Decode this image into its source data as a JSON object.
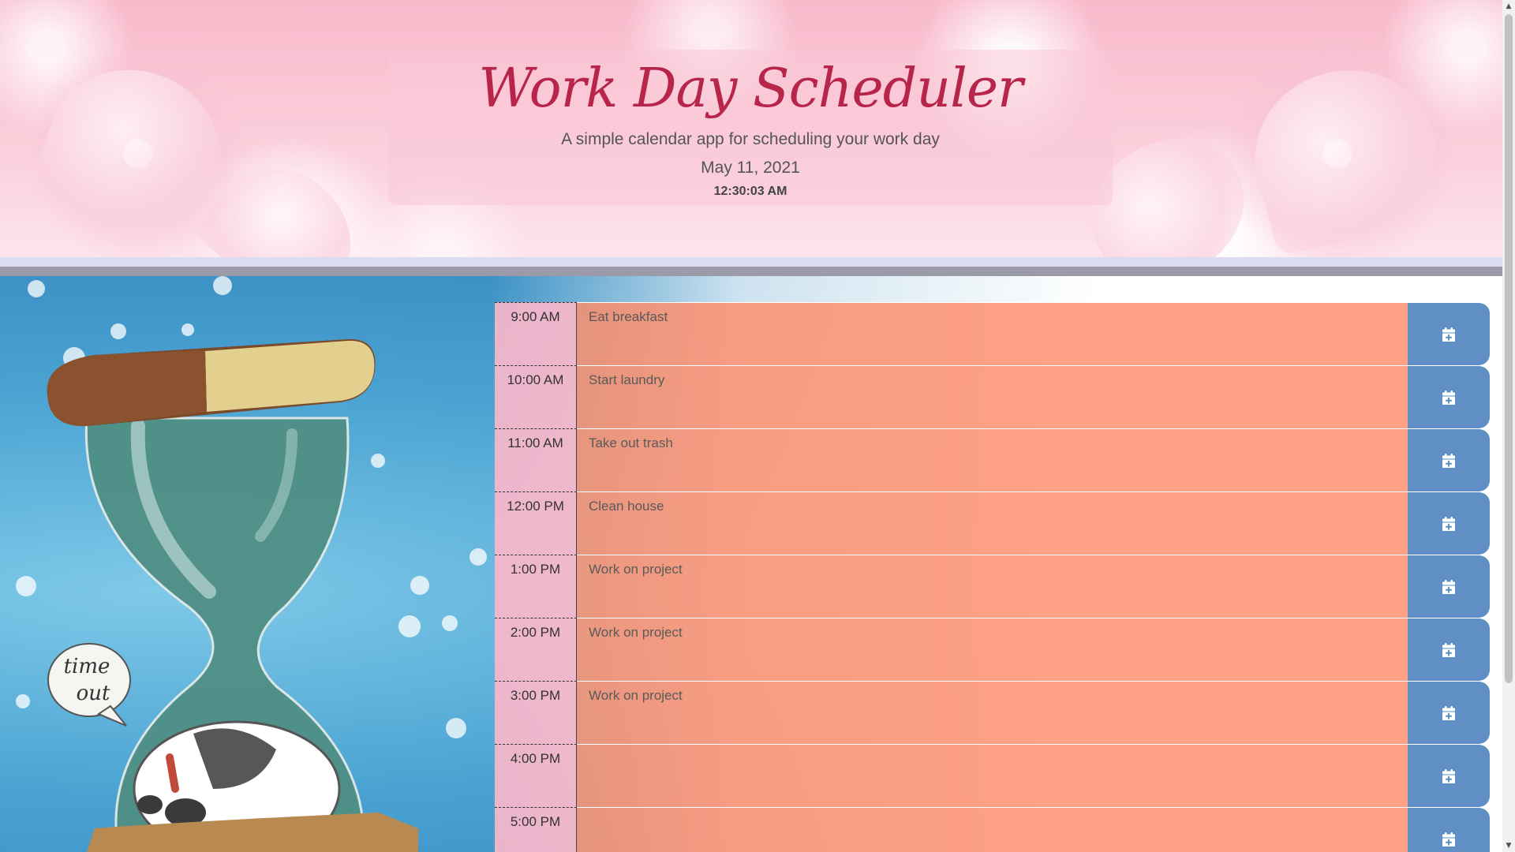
{
  "header": {
    "title": "Work Day Scheduler",
    "subtitle": "A simple calendar app for scheduling your work day",
    "date": "May 11, 2021",
    "time": "12:30:03 AM"
  },
  "illustration": {
    "speech_bubble_line1": "time",
    "speech_bubble_line2": "out"
  },
  "planner": {
    "rows": [
      {
        "hour": "9:00 AM",
        "text": "Eat breakfast"
      },
      {
        "hour": "10:00 AM",
        "text": "Start laundry"
      },
      {
        "hour": "11:00 AM",
        "text": "Take out trash"
      },
      {
        "hour": "12:00 PM",
        "text": "Clean house"
      },
      {
        "hour": "1:00 PM",
        "text": "Work on project"
      },
      {
        "hour": "2:00 PM",
        "text": "Work on project"
      },
      {
        "hour": "3:00 PM",
        "text": "Work on project"
      },
      {
        "hour": "4:00 PM",
        "text": ""
      },
      {
        "hour": "5:00 PM",
        "text": ""
      }
    ],
    "save_icon": "calendar-plus-icon"
  },
  "colors": {
    "hour_block": "#f8b6ca",
    "description_past": "#ff8c69",
    "save_button": "#5f8fc4",
    "title": "#b7264a"
  }
}
